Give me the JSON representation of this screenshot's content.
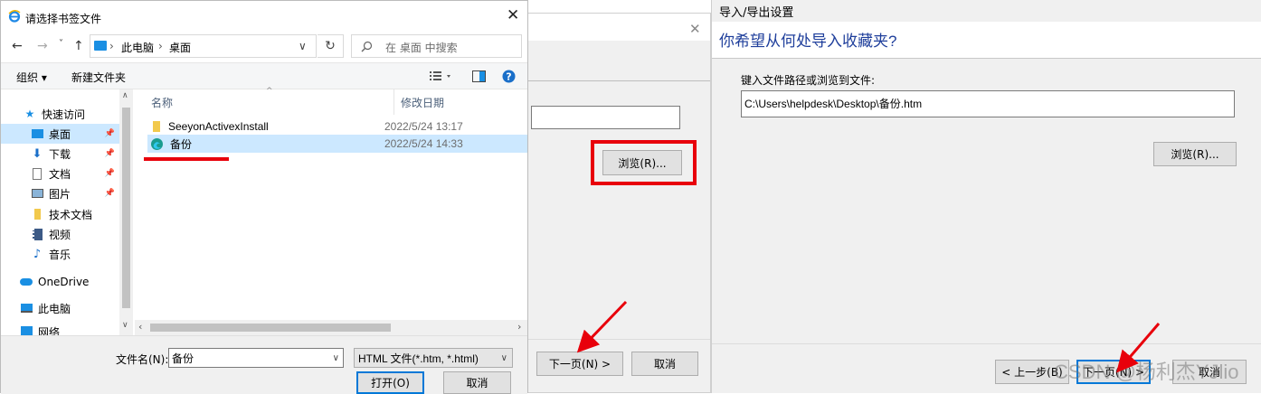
{
  "file_dialog": {
    "title": "请选择书签文件",
    "close_glyph": "✕",
    "nav_back_glyph": "←",
    "nav_forward_glyph": "→",
    "nav_recent_glyph": "˅",
    "nav_up_glyph": "↑",
    "address": {
      "root": "此电脑",
      "separator": "›",
      "current": "桌面",
      "dropdown_glyph": "∨"
    },
    "refresh_glyph": "↻",
    "search_placeholder": "在 桌面 中搜索",
    "toolbar": {
      "organize": "组织 ▾",
      "new_folder": "新建文件夹"
    },
    "sidebar": [
      {
        "label": "快速访问",
        "icon": "star-icon"
      },
      {
        "label": "桌面",
        "icon": "desktop-icon",
        "selected": true,
        "pinned": true
      },
      {
        "label": "下载",
        "icon": "download-icon",
        "pinned": true
      },
      {
        "label": "文档",
        "icon": "document-icon",
        "pinned": true
      },
      {
        "label": "图片",
        "icon": "picture-icon",
        "pinned": true
      },
      {
        "label": "技术文档",
        "icon": "folder-icon"
      },
      {
        "label": "视频",
        "icon": "video-icon"
      },
      {
        "label": "音乐",
        "icon": "music-icon"
      },
      {
        "label": "OneDrive",
        "icon": "cloud-icon"
      },
      {
        "label": "此电脑",
        "icon": "computer-icon"
      },
      {
        "label": "网络",
        "icon": "network-icon"
      }
    ],
    "columns": {
      "name": "名称",
      "modified": "修改日期"
    },
    "files": [
      {
        "name": "SeeyonActivexInstall",
        "date": "2022/5/24 13:17",
        "icon": "folder-icon"
      },
      {
        "name": "备份",
        "date": "2022/5/24 14:33",
        "icon": "edge-icon",
        "selected": true
      }
    ],
    "filename_label": "文件名(N):",
    "filename_value": "备份",
    "filetype_value": "HTML 文件(*.htm, *.html)",
    "open_button": "打开(O)",
    "cancel_button": "取消"
  },
  "middle_dialog": {
    "close_glyph": "✕",
    "browse_button": "浏览(R)...",
    "next_button": "下一页(N) >",
    "cancel_button": "取消"
  },
  "wizard": {
    "title": "导入/导出设置",
    "heading": "你希望从何处导入收藏夹?",
    "path_label": "键入文件路径或浏览到文件:",
    "path_value": "C:\\Users\\helpdesk\\Desktop\\备份.htm",
    "browse_button": "浏览(R)...",
    "back_button": "< 上一步(B)",
    "next_button": "下一页(N) >",
    "cancel_button": "取消",
    "watermark": "CSDN @杨利杰YJlio"
  },
  "annotations": {
    "highlight_color": "#e8000b"
  }
}
